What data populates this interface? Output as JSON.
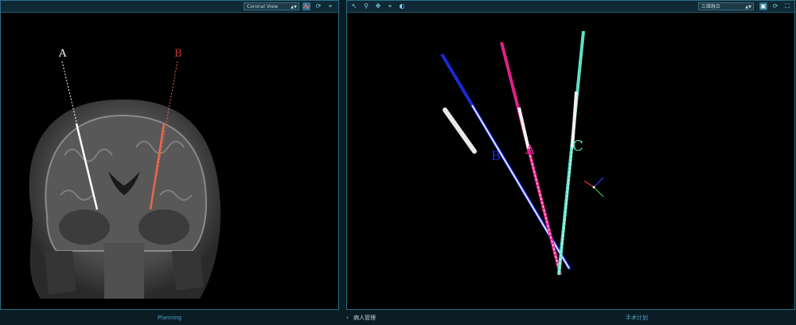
{
  "left_view": {
    "view_select": "Coronal View",
    "electrode_labels": {
      "a": "A",
      "b": "B"
    },
    "tools": [
      "waveform-icon",
      "refresh-icon",
      "crosshair-icon"
    ]
  },
  "right_view": {
    "view_select": "三维融合",
    "electrode_labels": {
      "a": "A",
      "b": "B",
      "c": "C"
    },
    "tools_left": [
      "pointer-icon",
      "zoom-icon",
      "pan-icon",
      "crosshair-icon",
      "contrast-icon"
    ],
    "tools_right": [
      "layout-icon",
      "refresh-icon",
      "fit-icon"
    ]
  },
  "status": {
    "left_title": "Planning",
    "back_label": "病人管理",
    "right_title": "手术计划"
  },
  "colors": {
    "frame": "#2b6e86",
    "toolbar": "#0f2a36",
    "accent_text": "#4fa6cb",
    "electrode_a": "#ffffff",
    "electrode_b_left": "#e8674d",
    "electrode_b": "#1a2ad8",
    "electrode_a_3d": "#e0208a",
    "electrode_c": "#5fe0c8"
  }
}
